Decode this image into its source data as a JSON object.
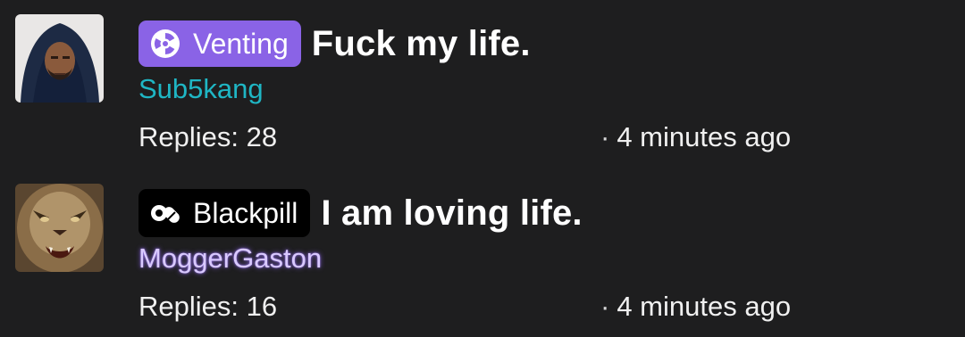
{
  "threads": [
    {
      "avatar": "user-avatar-hooded-man",
      "tag": {
        "label": "Venting",
        "icon": "radiation-icon",
        "color": "#8a63e6"
      },
      "title": "Fuck my life.",
      "author": "Sub5kang",
      "author_color": "#1fb6c4",
      "replies": "Replies: 28",
      "separator": "·",
      "time": "4 minutes ago"
    },
    {
      "avatar": "user-avatar-lion",
      "tag": {
        "label": "Blackpill",
        "icon": "pills-icon",
        "color": "#000000"
      },
      "title": "I am loving life.",
      "author": "MoggerGaston",
      "author_color": "#d9c9ff",
      "replies": "Replies: 16",
      "separator": "·",
      "time": "4 minutes ago"
    }
  ]
}
